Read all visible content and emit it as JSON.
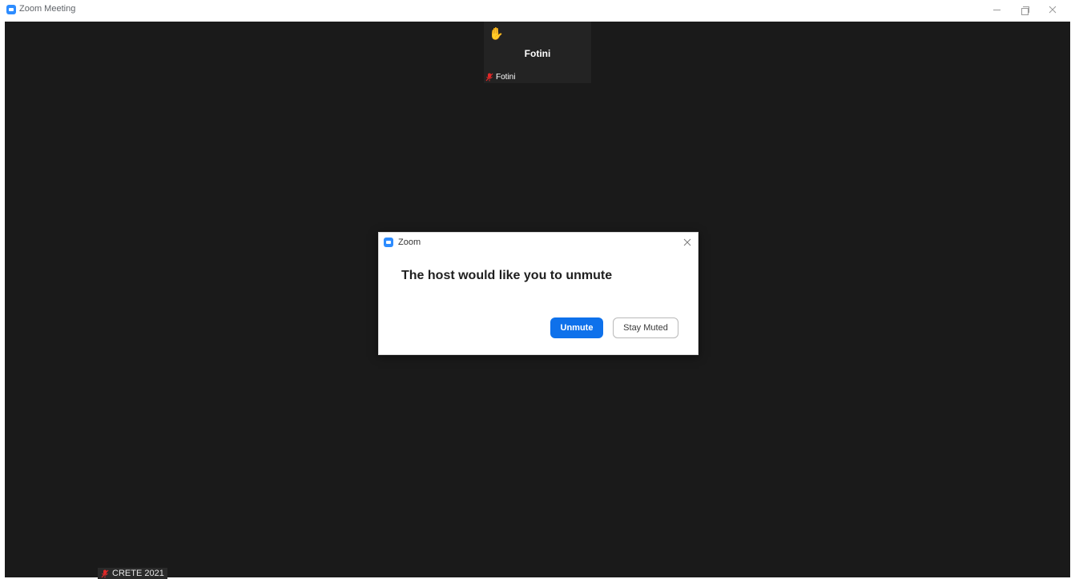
{
  "window": {
    "title": "Zoom Meeting",
    "controls": {
      "minimize": "minimize",
      "maximize": "restore",
      "close": "close"
    }
  },
  "participant_tile": {
    "name": "Fotini",
    "name_tag": "Fotini",
    "status_icon": "raised-hand-icon",
    "mic_state": "muted"
  },
  "self_tag": {
    "name": "CRETE 2021",
    "mic_state": "muted"
  },
  "dialog": {
    "title": "Zoom",
    "message": "The host would like you to unmute",
    "primary_button": "Unmute",
    "secondary_button": "Stay Muted"
  },
  "colors": {
    "meeting_background": "#1a1a1a",
    "accent": "#0e71eb",
    "zoom_blue": "#2d8cff",
    "muted_red": "#e02828"
  }
}
